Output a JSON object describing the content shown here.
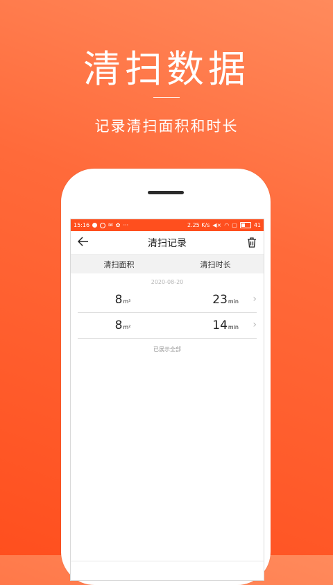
{
  "hero": {
    "title": "清扫数据",
    "subtitle": "记录清扫面积和时长"
  },
  "status_bar": {
    "time": "15:16",
    "speed": "2.25 K/s",
    "battery": "41",
    "bg_color": "#ff4f1e"
  },
  "header": {
    "back_icon": "back-arrow-icon",
    "title": "清扫记录",
    "action_icon": "trash-icon"
  },
  "tabs": [
    "清扫面积",
    "清扫时长"
  ],
  "date": "2020-08-20",
  "records": [
    {
      "area_value": "8",
      "area_unit": "m²",
      "duration_value": "23",
      "duration_unit": "min"
    },
    {
      "area_value": "8",
      "area_unit": "m²",
      "duration_value": "14",
      "duration_unit": "min"
    }
  ],
  "footer_text": "已展示全部",
  "colors": {
    "accent": "#ff5a26"
  }
}
